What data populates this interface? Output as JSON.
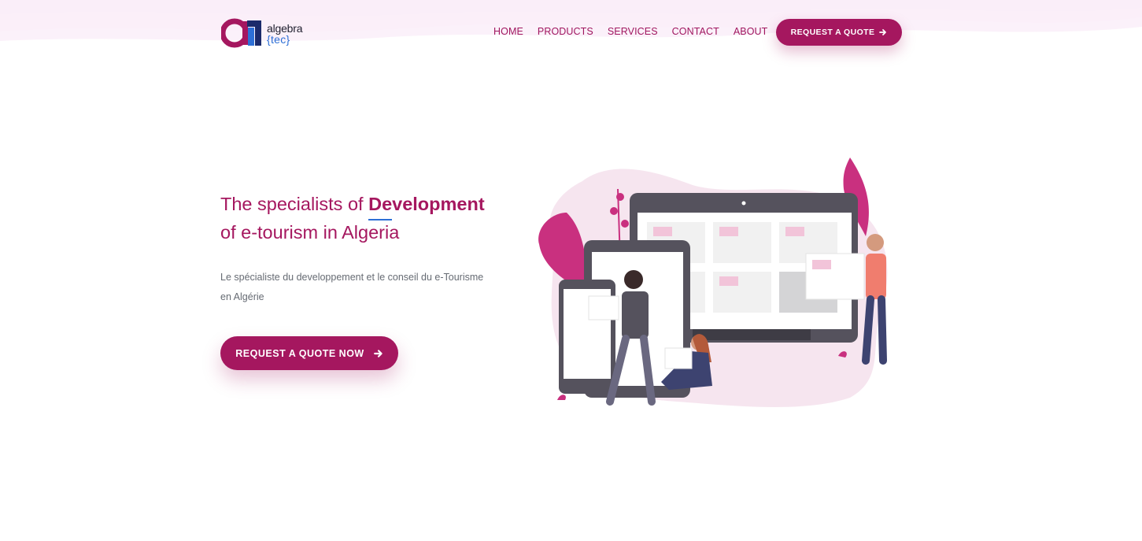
{
  "header": {
    "logo": {
      "mark": "a1",
      "line1": "algebra",
      "line2": "{tec}"
    },
    "nav": [
      {
        "label": "HOME"
      },
      {
        "label": "PRODUCTS"
      },
      {
        "label": "SERVICES"
      },
      {
        "label": "CONTACT"
      },
      {
        "label": "ABOUT"
      }
    ],
    "cta_label": "REQUEST A QUOTE",
    "cta_icon": "arrow-right-icon"
  },
  "hero": {
    "title_prefix": "The specialists of ",
    "title_highlight": "Development",
    "title_line2": "of e-tourism in Algeria",
    "subtitle": "Le spécialiste du developpement et le conseil du e-Tourisme en Algérie",
    "cta_label": "REQUEST A QUOTE NOW",
    "cta_icon": "arrow-right-icon"
  },
  "colors": {
    "brand": "#a5175f",
    "accent_blue": "#2d6fd6",
    "text_muted": "#666b73",
    "wave": "#f3d6ec"
  }
}
